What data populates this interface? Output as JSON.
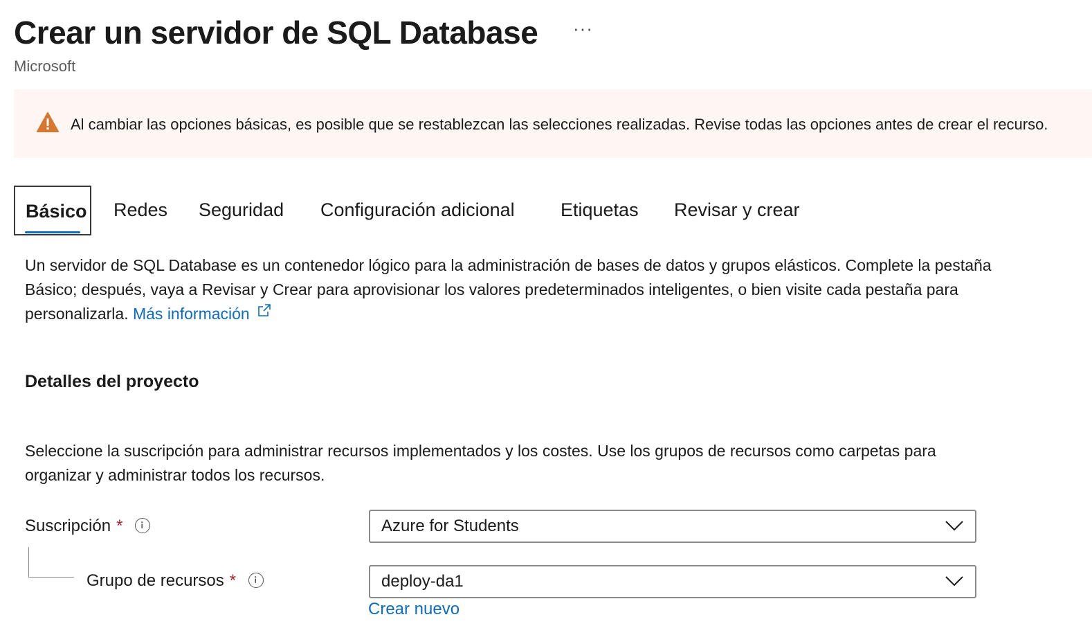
{
  "header": {
    "title": "Crear un servidor de SQL Database",
    "more_label": "···",
    "subtitle": "Microsoft"
  },
  "banner": {
    "icon": "warning-icon",
    "text": "Al cambiar las opciones básicas, es posible que se restablezcan las selecciones realizadas. Revise todas las opciones antes de crear el recurso.",
    "color": "#fdf6f3",
    "icon_color": "#d67730"
  },
  "tabs": [
    {
      "label": "Básico",
      "active": true
    },
    {
      "label": "Redes",
      "active": false
    },
    {
      "label": "Seguridad",
      "active": false
    },
    {
      "label": "Configuración adicional",
      "active": false
    },
    {
      "label": "Etiquetas",
      "active": false
    },
    {
      "label": "Revisar y crear",
      "active": false
    }
  ],
  "intro": {
    "text": "Un servidor de SQL Database es un contenedor lógico para la administración de bases de datos y grupos elásticos. Complete la pestaña Básico; después, vaya a Revisar y Crear para aprovisionar los valores predeterminados inteligentes, o bien visite cada pestaña para personalizarla.",
    "link_label": "Más información",
    "link_icon": "external-link-icon"
  },
  "project_details": {
    "title": "Detalles del proyecto",
    "description": "Seleccione la suscripción para administrar recursos implementados y los costes. Use los grupos de recursos como carpetas para organizar y administrar todos los recursos.",
    "subscription": {
      "label": "Suscripción",
      "required_mark": "*",
      "value": "Azure for Students"
    },
    "resource_group": {
      "label": "Grupo de recursos",
      "required_mark": "*",
      "value": "deploy-da1",
      "create_new_label": "Crear nuevo"
    }
  },
  "colors": {
    "accent": "#0f6cbd",
    "required": "#a4262c"
  }
}
